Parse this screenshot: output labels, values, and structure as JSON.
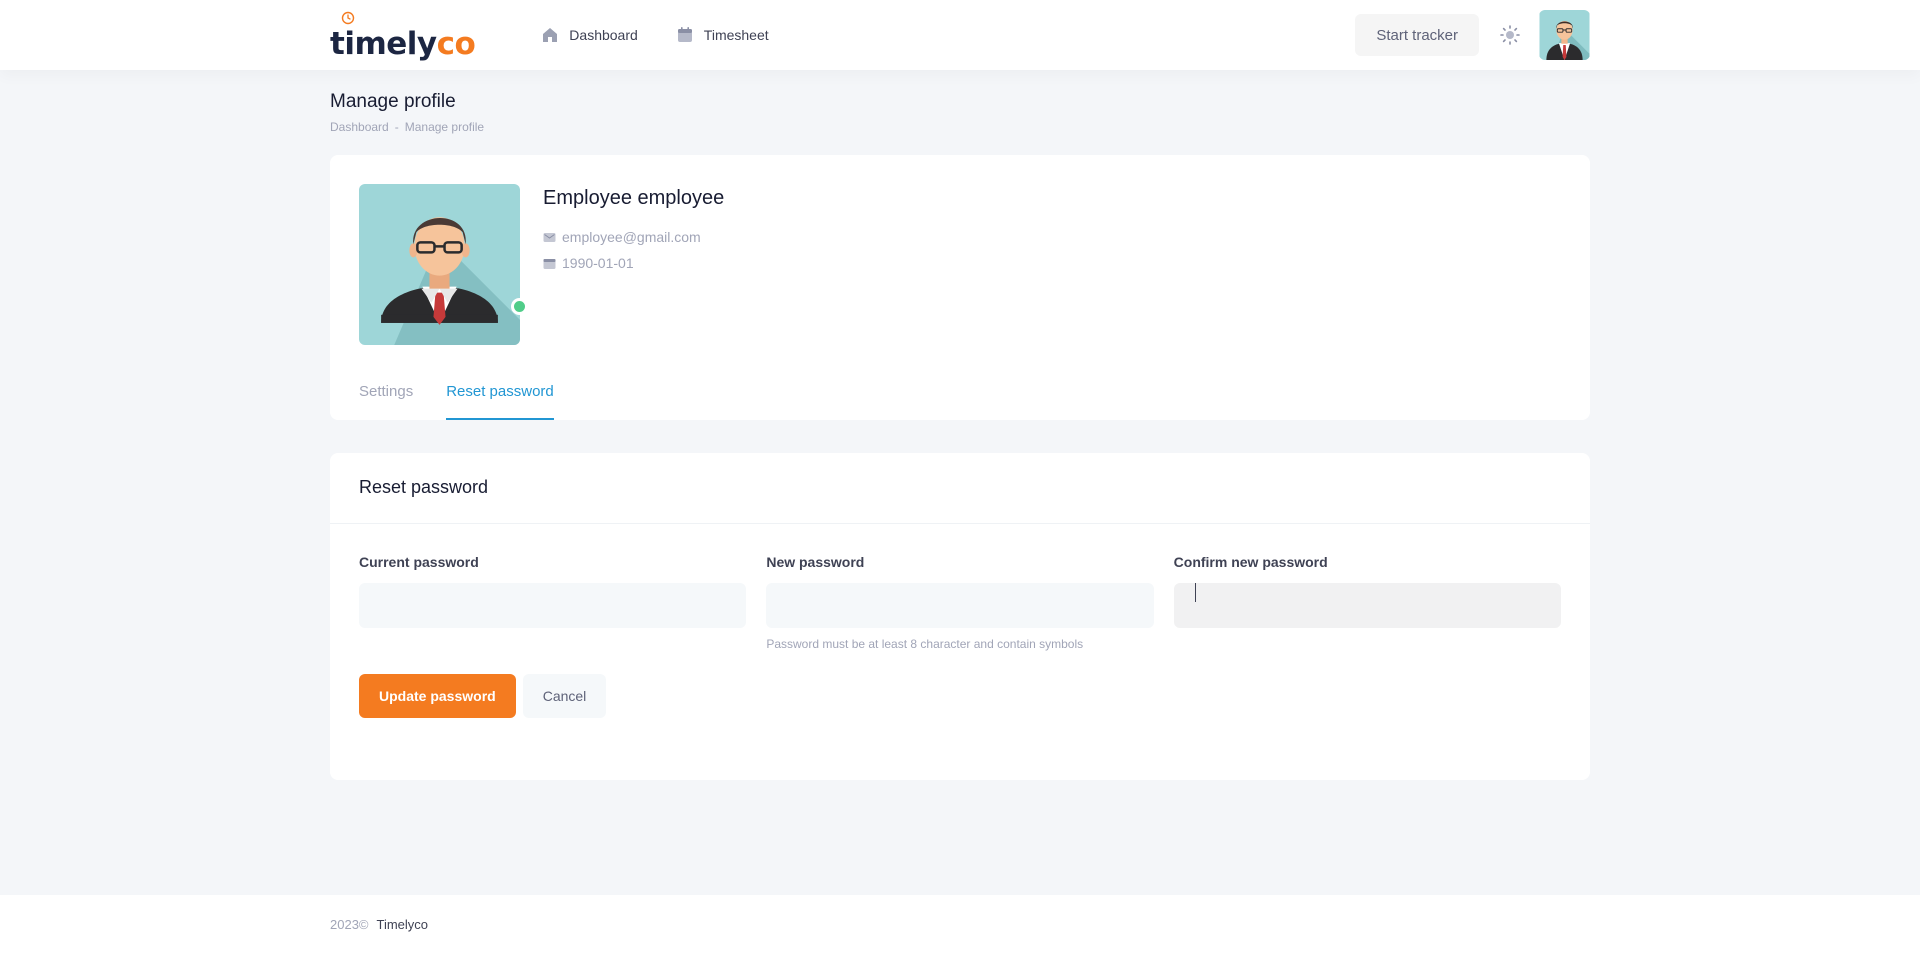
{
  "header": {
    "logo_text_main": "timely",
    "logo_text_accent": "co",
    "nav": [
      {
        "label": "Dashboard",
        "icon": "home-icon"
      },
      {
        "label": "Timesheet",
        "icon": "calendar-icon"
      }
    ],
    "tracker_button": "Start tracker",
    "theme_icon": "sun-icon",
    "avatar_icon": "user-avatar"
  },
  "page": {
    "title": "Manage profile",
    "breadcrumb": [
      "Dashboard",
      "-",
      "Manage profile"
    ]
  },
  "profile": {
    "name": "Employee employee",
    "email": "employee@gmail.com",
    "birthdate": "1990-01-01",
    "status_color": "#50cd89",
    "tabs": [
      {
        "label": "Settings",
        "active": false
      },
      {
        "label": "Reset password",
        "active": true
      }
    ]
  },
  "reset": {
    "title": "Reset password",
    "fields": [
      {
        "label": "Current password",
        "value": "",
        "hint": ""
      },
      {
        "label": "New password",
        "value": "",
        "hint": "Password must be at least 8 character and contain symbols"
      },
      {
        "label": "Confirm new password",
        "value": "",
        "hint": ""
      }
    ],
    "submit_label": "Update password",
    "cancel_label": "Cancel"
  },
  "footer": {
    "year": "2023©",
    "brand": "Timelyco"
  },
  "colors": {
    "accent": "#f47b20",
    "tab_active": "#2196d3",
    "background": "#f4f6f9"
  }
}
